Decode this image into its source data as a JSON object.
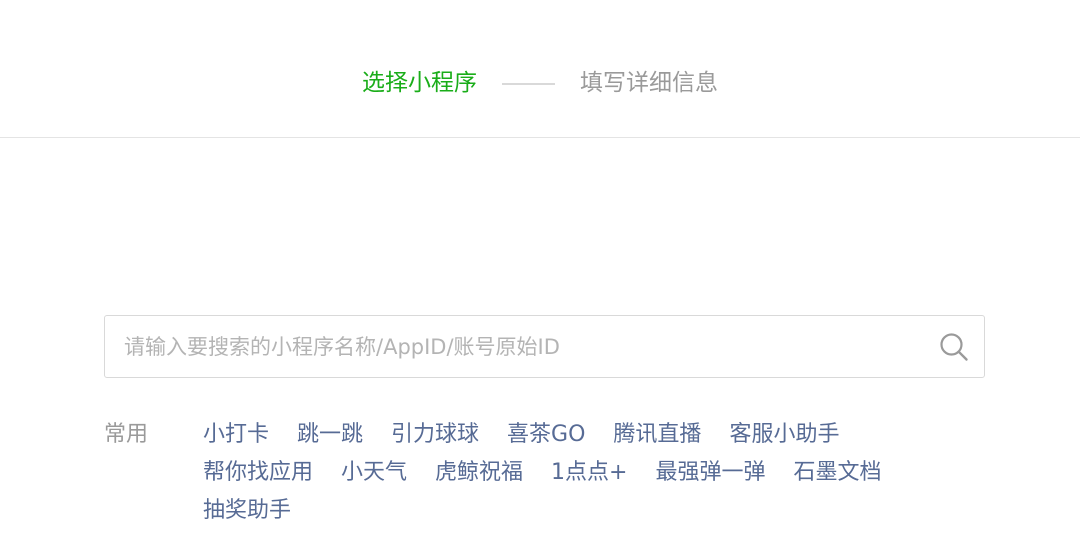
{
  "steps": {
    "step1": "选择小程序",
    "step2": "填写详细信息"
  },
  "search": {
    "placeholder": "请输入要搜索的小程序名称/AppID/账号原始ID",
    "value": ""
  },
  "common": {
    "label": "常用",
    "items": [
      "小打卡",
      "跳一跳",
      "引力球球",
      "喜茶GO",
      "腾讯直播",
      "客服小助手",
      "帮你找应用",
      "小天气",
      "虎鲸祝福",
      "1点点+",
      "最强弹一弹",
      "石墨文档",
      "抽奖助手"
    ]
  },
  "colors": {
    "active_step": "#1aad19",
    "inactive_step": "#9a9a9a",
    "link": "#576b95",
    "border": "#d9d9d9"
  },
  "icons": {
    "search": "search-icon"
  }
}
